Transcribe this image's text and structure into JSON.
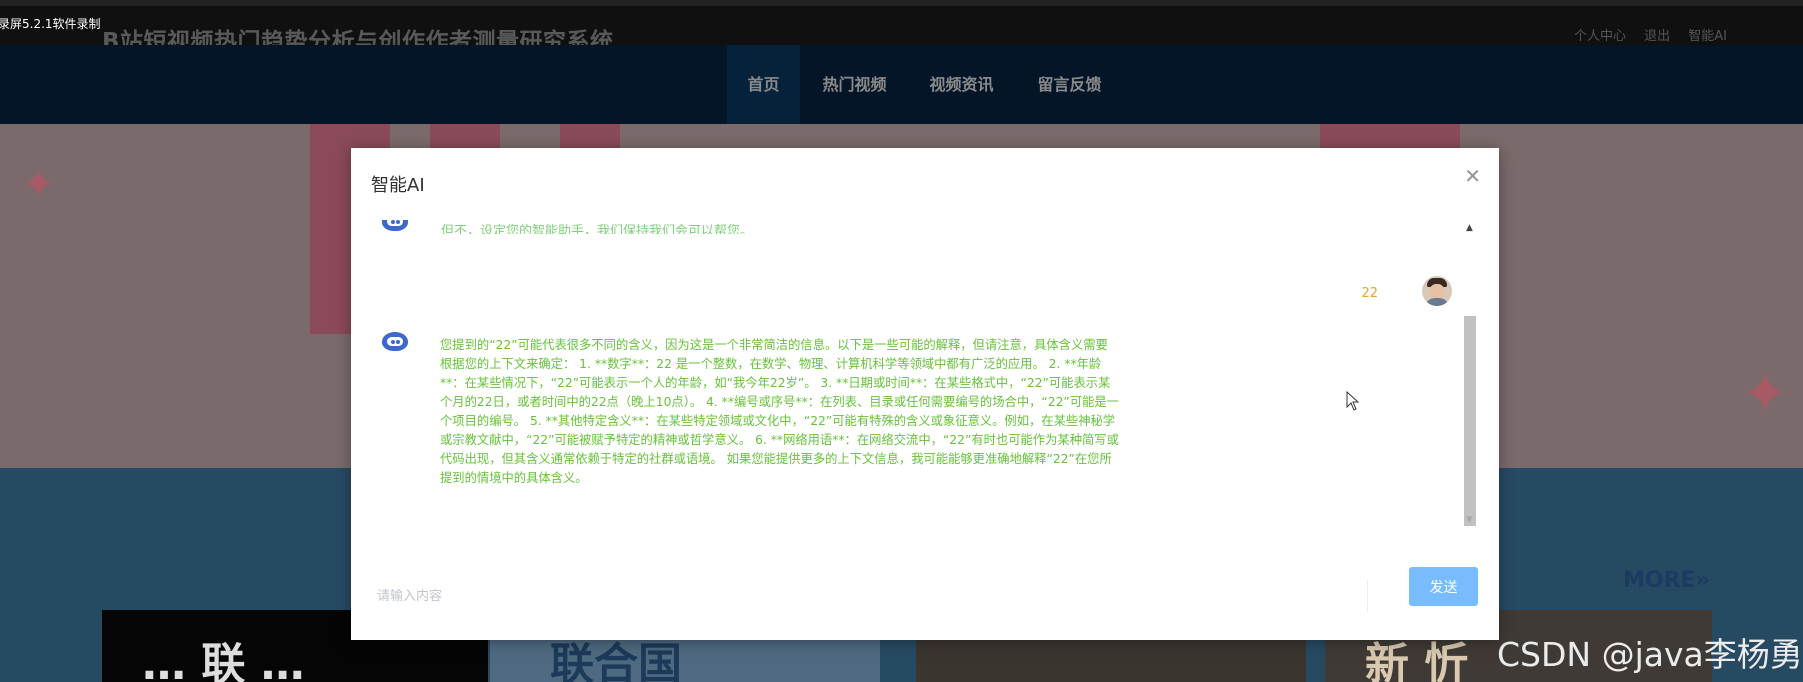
{
  "recorder": {
    "label": "录屏5.2.1软件录制"
  },
  "site": {
    "title": "B站短视频热门趋势分析与创作作者测量研究系统",
    "top_links": [
      "个人中心",
      "退出",
      "智能AI"
    ]
  },
  "nav": {
    "items": [
      "首页",
      "热门视频",
      "视频资讯",
      "留言反馈"
    ],
    "active_index": 0
  },
  "more_link": "MORE»",
  "thumbnails": [
    "… 联 …",
    "联合国",
    "",
    "新 忻"
  ],
  "watermark": "CSDN @java李杨勇",
  "modal": {
    "title": "智能AI",
    "close_icon": "close-icon",
    "clipped_text": "但不，设定您的智能助手，我们保持我们会可以帮您。",
    "user_message": "22",
    "bot_reply": "您提到的“22”可能代表很多不同的含义，因为这是一个非常简洁的信息。以下是一些可能的解释，但请注意，具体含义需要根据您的上下文来确定： 1. **数字**：22 是一个整数，在数学、物理、计算机科学等领域中都有广泛的应用。 2. **年龄**：在某些情况下，“22”可能表示一个人的年龄，如“我今年22岁”。 3. **日期或时间**：在某些格式中，“22”可能表示某个月的22日，或者时间中的22点（晚上10点）。 4. **编号或序号**：在列表、目录或任何需要编号的场合中，“22”可能是一个项目的编号。 5. **其他特定含义**：在某些特定领域或文化中，“22”可能有特殊的含义或象征意义。例如，在某些神秘学或宗教文献中，“22”可能被赋予特定的精神或哲学意义。 6. **网络用语**：在网络交流中，“22”有时也可能作为某种简写或代码出现，但其含义通常依赖于特定的社群或语境。 如果您能提供更多的上下文信息，我可能能够更准确地解释“22”在您所提到的情境中的具体含义。",
    "input": {
      "placeholder": "请输入内容",
      "value": ""
    },
    "send_label": "发送"
  },
  "colors": {
    "bot_text": "#67c23a",
    "user_text": "#e6a23c",
    "send_button": "#79bbff",
    "navbar": "#031527"
  }
}
